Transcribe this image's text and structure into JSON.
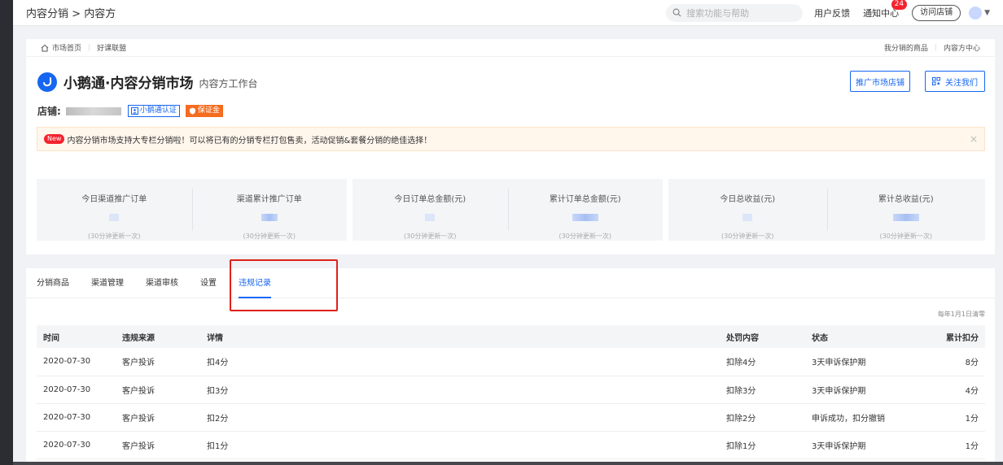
{
  "breadcrumb": {
    "root": "内容分销",
    "sep": ">",
    "current": "内容方"
  },
  "topbar": {
    "search_placeholder": "搜索功能与帮助",
    "feedback": "用户反馈",
    "notify": "通知中心",
    "notify_count": "24",
    "visit_shop": "访问店铺"
  },
  "subnav": {
    "home": "市场首页",
    "partner": "好课联盟",
    "my_goods": "我分销的商品",
    "center": "内容方中心"
  },
  "header": {
    "title": "小鹅通·内容分销市场",
    "subtitle": "内容方工作台",
    "promote_btn": "推广市场店铺",
    "follow_btn": "关注我们",
    "shop_label": "店铺:",
    "tag_verified": "小鹅通认证",
    "tag_deposit": "保证金"
  },
  "notice": {
    "new": "New",
    "text": "内容分销市场支持大专栏分销啦！可以将已有的分销专栏打包售卖，活动促销&套餐分销的绝佳选择！",
    "close": "×"
  },
  "stats": [
    [
      {
        "label": "今日渠道推广订单",
        "note": "(30分钟更新一次)"
      },
      {
        "label": "渠道累计推广订单",
        "note": "(30分钟更新一次)"
      }
    ],
    [
      {
        "label": "今日订单总金额(元)",
        "note": "(30分钟更新一次)"
      },
      {
        "label": "累计订单总金额(元)",
        "note": "(30分钟更新一次)"
      }
    ],
    [
      {
        "label": "今日总收益(元)",
        "note": "(30分钟更新一次)"
      },
      {
        "label": "累计总收益(元)",
        "note": "(30分钟更新一次)"
      }
    ]
  ],
  "tabs": [
    "分销商品",
    "渠道管理",
    "渠道审核",
    "设置",
    "违规记录"
  ],
  "reset_note": "每年1月1日清零",
  "table": {
    "headers": [
      "时间",
      "违规来源",
      "详情",
      "处罚内容",
      "状态",
      "累计扣分"
    ],
    "rows": [
      [
        "2020-07-30",
        "客户投诉",
        "扣4分",
        "扣除4分",
        "3天申诉保护期",
        "8分"
      ],
      [
        "2020-07-30",
        "客户投诉",
        "扣3分",
        "扣除3分",
        "3天申诉保护期",
        "4分"
      ],
      [
        "2020-07-30",
        "客户投诉",
        "扣2分",
        "扣除2分",
        "申诉成功，扣分撤销",
        "1分"
      ],
      [
        "2020-07-30",
        "客户投诉",
        "扣1分",
        "扣除1分",
        "3天申诉保护期",
        "1分"
      ]
    ]
  },
  "colors": {
    "brand": "#1666f2",
    "danger": "#e0201c",
    "orange": "#f56c1f"
  }
}
